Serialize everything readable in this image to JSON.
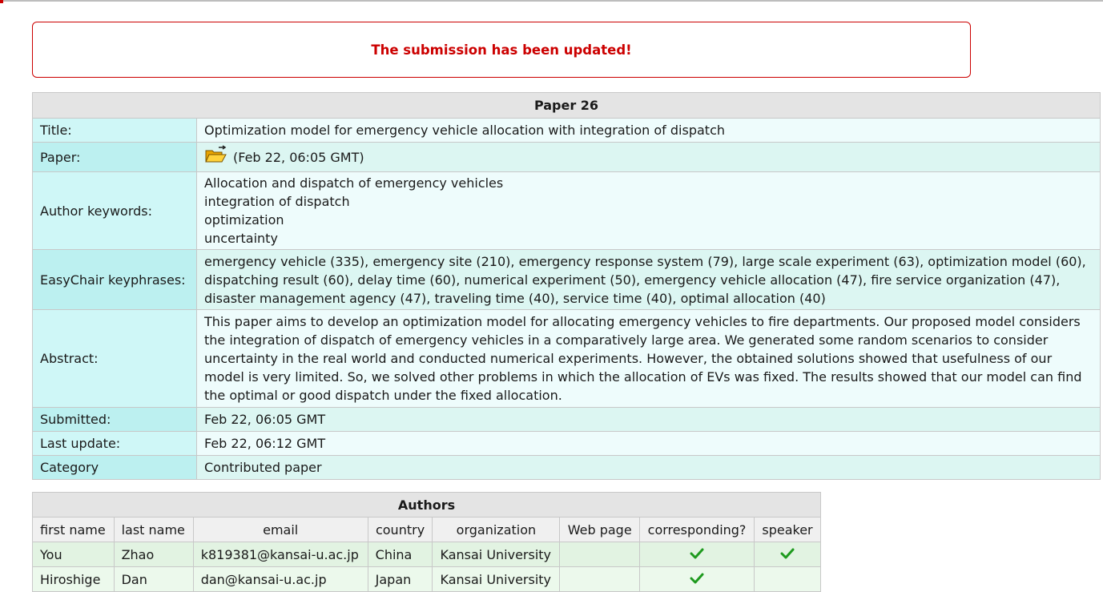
{
  "notice": {
    "message": "The submission has been updated!"
  },
  "paper": {
    "heading": "Paper 26",
    "title_label": "Title:",
    "title": "Optimization model for emergency vehicle allocation with integration of dispatch",
    "paper_label": "Paper:",
    "paper_file_date": "(Feb 22, 06:05 GMT)",
    "paper_icon": "folder-open-icon",
    "keywords_label": "Author keywords:",
    "keywords": [
      "Allocation and dispatch of emergency vehicles",
      "integration of dispatch",
      "optimization",
      "uncertainty"
    ],
    "keyphrases_label": "EasyChair keyphrases:",
    "keyphrases": "emergency vehicle (335), emergency site (210), emergency response system (79), large scale experiment (63), optimization model (60), dispatching result (60), delay time (60), numerical experiment (50), emergency vehicle allocation (47), fire service organization (47), disaster management agency (47), traveling time (40), service time (40), optimal allocation (40)",
    "abstract_label": "Abstract:",
    "abstract": "This paper aims to develop an optimization model for allocating emergency vehicles to fire departments. Our proposed model considers the integration of dispatch of emergency vehicles in a comparatively large area. We generated some random scenarios to consider uncertainty in the real world and conducted numerical experiments. However, the obtained solutions showed that usefulness of our model is very limited. So, we solved other problems in which the allocation of EVs was fixed. The results showed that our model can find the optimal or good dispatch under the fixed allocation.",
    "submitted_label": "Submitted:",
    "submitted": "Feb 22, 06:05 GMT",
    "last_update_label": "Last update:",
    "last_update": "Feb 22, 06:12 GMT",
    "category_label": "Category",
    "category": "Contributed paper"
  },
  "authors": {
    "heading": "Authors",
    "columns": [
      "first name",
      "last name",
      "email",
      "country",
      "organization",
      "Web page",
      "corresponding?",
      "speaker"
    ],
    "rows": [
      {
        "first": "You",
        "last": "Zhao",
        "email": "k819381@kansai-u.ac.jp",
        "country": "China",
        "organization": "Kansai University",
        "web": "",
        "corresponding": true,
        "speaker": true
      },
      {
        "first": "Hiroshige",
        "last": "Dan",
        "email": "dan@kansai-u.ac.jp",
        "country": "Japan",
        "organization": "Kansai University",
        "web": "",
        "corresponding": true,
        "speaker": false
      }
    ]
  },
  "colors": {
    "notice_red": "#cc0000",
    "check_green": "#1e9a1e"
  }
}
